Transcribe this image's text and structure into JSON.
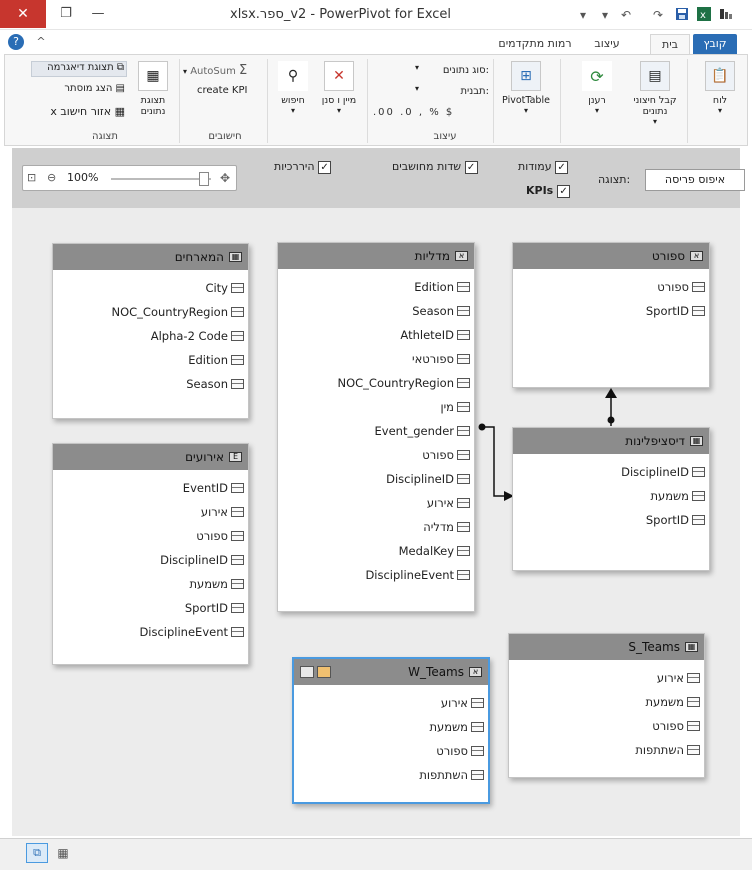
{
  "window": {
    "title": "PowerPivot for Excel",
    "file_name": "xlsx.ספר_v2",
    "close_glyph": "✕",
    "restore_glyph": "❐",
    "minimize_glyph": "—",
    "help_glyph": "?",
    "ribbon_collapse_glyph": "^"
  },
  "ribbon": {
    "tabs": [
      {
        "label": "קובץ"
      },
      {
        "label": "בית"
      },
      {
        "label": "עיצוב"
      },
      {
        "label": "רמות מתקדמים"
      }
    ],
    "groups": {
      "view_label": "תצוגה",
      "calc_label": "חישובים",
      "format_label": "עיצוב"
    },
    "buttons": {
      "paste": "לוח",
      "get_data": "קבל חיצוני נתונים",
      "refresh": "רענן",
      "pivot": "PivotTable",
      "sort": "מיין ו סנן",
      "find": "חיפוש",
      "data_type": "סוג נתונים:",
      "format": "תבנית:",
      "autosum": "AutoSum",
      "create_kpi": "create KPI",
      "data_view": "תצוגת נתונים",
      "diagram_view": "תצוגת דיאגרמה",
      "show_hidden": "הצג מוסתר",
      "calc_area": "אזור חישוב",
      "calc_area_x": "x"
    }
  },
  "viewbar": {
    "columns": "עמודות",
    "calculated_fields": "שדות מחושבים",
    "hierarchies": "היררכיות",
    "kpis": "KPIs",
    "view_label": "תצוגה:",
    "reset_layout": "איפוס פריסה",
    "zoom": "100%"
  },
  "tables": {
    "sport": {
      "title": "ספורט",
      "fields": [
        "ספורט",
        "SportID"
      ]
    },
    "discipline": {
      "title": "דיסציפלינות",
      "fields": [
        "DisciplineID",
        "משמעת",
        "SportID"
      ]
    },
    "hosts": {
      "title": "המארחים",
      "fields": [
        "City",
        "NOC_CountryRegion",
        "Alpha-2 Code",
        "Edition",
        "Season"
      ]
    },
    "medals": {
      "title": "מדליות",
      "fields": [
        "Edition",
        "Season",
        "AthleteID",
        "ספורטאי",
        "NOC_CountryRegion",
        "מין",
        "Event_gender",
        "ספורט",
        "DisciplineID",
        "אירוע",
        "מדליה",
        "MedalKey",
        "DisciplineEvent"
      ]
    },
    "events": {
      "title": "אירועים",
      "fields": [
        "EventID",
        "אירוע",
        "ספורט",
        "DisciplineID",
        "משמעת",
        "SportID",
        "DisciplineEvent"
      ]
    },
    "teams_s": {
      "title": "S_Teams",
      "fields": [
        "אירוע",
        "משמעת",
        "ספורט",
        "השתתפות"
      ]
    },
    "teams_w": {
      "title": "W_Teams",
      "fields": [
        "אירוע",
        "משמעת",
        "ספורט",
        "השתתפות"
      ]
    }
  },
  "colors": {
    "accent": "#2a6db5",
    "close": "#c7362e",
    "selection": "#4a9ae0",
    "table_header": "#8c8c8c"
  }
}
